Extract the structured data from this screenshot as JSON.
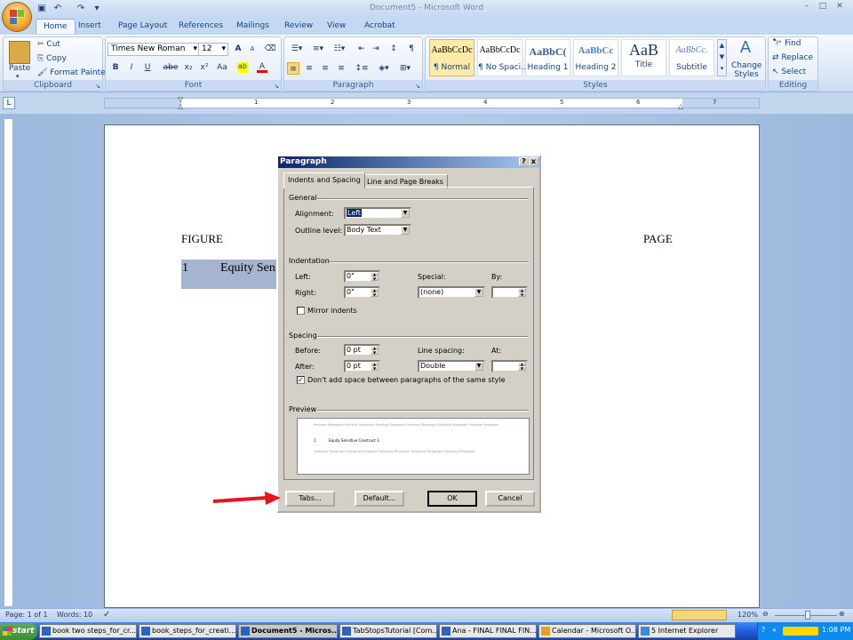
{
  "window": {
    "title": "Document5 - Microsoft Word"
  },
  "qat": {
    "save_icon": "save-icon",
    "undo_icon": "undo-icon",
    "redo_icon": "redo-icon"
  },
  "tabs": [
    "Home",
    "Insert",
    "Page Layout",
    "References",
    "Mailings",
    "Review",
    "View",
    "Acrobat"
  ],
  "clipboard": {
    "paste": "Paste",
    "cut": "Cut",
    "copy": "Copy",
    "format_painter": "Format Painter",
    "label": "Clipboard"
  },
  "font": {
    "name": "Times New Roman",
    "size": "12",
    "label": "Font",
    "bold": "B",
    "italic": "I",
    "underline": "U",
    "strike": "abe",
    "sub": "x₂",
    "sup": "x²",
    "case": "Aa",
    "grow": "A",
    "shrink": "A"
  },
  "paragraph": {
    "label": "Paragraph"
  },
  "styles": {
    "label": "Styles",
    "items": [
      {
        "sample": "AaBbCcDc",
        "name": "¶ Normal"
      },
      {
        "sample": "AaBbCcDc",
        "name": "¶ No Spaci..."
      },
      {
        "sample": "AaBbC(",
        "name": "Heading 1"
      },
      {
        "sample": "AaBbCc",
        "name": "Heading 2"
      },
      {
        "sample": "AaB",
        "name": "Title"
      },
      {
        "sample": "AaBbCc.",
        "name": "Subtitle"
      }
    ],
    "change_styles": "Change Styles"
  },
  "editing": {
    "label": "Editing",
    "find": "Find",
    "replace": "Replace",
    "select": "Select"
  },
  "ruler": {
    "marks": [
      "1",
      "2",
      "3",
      "4",
      "5",
      "6",
      "7"
    ]
  },
  "document": {
    "figure": "FIGURE",
    "page": "PAGE",
    "entry_num": "1",
    "entry_text": "Equity Sen"
  },
  "dialog": {
    "title": "Paragraph",
    "help": "?",
    "close": "x",
    "tabs": [
      "Indents and Spacing",
      "Line and Page Breaks"
    ],
    "general": "General",
    "alignment_label": "Alignment:",
    "alignment_value": "Left",
    "outline_label": "Outline level:",
    "outline_value": "Body Text",
    "indentation": "Indentation",
    "left_label": "Left:",
    "left_value": "0\"",
    "right_label": "Right:",
    "right_value": "0\"",
    "special_label": "Special:",
    "special_value": "(none)",
    "by_label": "By:",
    "mirror_label": "Mirror indents",
    "spacing": "Spacing",
    "before_label": "Before:",
    "before_value": "0 pt",
    "after_label": "After:",
    "after_value": "0 pt",
    "line_spacing_label": "Line spacing:",
    "line_spacing_value": "Double",
    "at_label": "At:",
    "dont_add_label": "Don't add space between paragraphs of the same style",
    "preview": "Preview",
    "preview_prev": "Previous Paragraph Previous Paragraph Previous Paragraph Previous Paragraph Previous Paragraph Previous Paragraph",
    "preview_num": "1",
    "preview_text": "Equity Sensitive Construct    3",
    "preview_follow": "Following Paragraph Following Paragraph Following Paragraph Following Paragraph Following Paragraph",
    "tabs_btn": "Tabs...",
    "default_btn": "Default...",
    "ok_btn": "OK",
    "cancel_btn": "Cancel"
  },
  "status": {
    "page": "Page: 1 of 1",
    "words": "Words: 10",
    "zoom": "120%"
  },
  "taskbar": {
    "start": "start",
    "tasks": [
      "book two steps_for_cr...",
      "book_steps_for_creati...",
      "Document5 - Micros...",
      "TabStopsTutorial [Com...",
      "Ana - FINAL FINAL FIN...",
      "Calendar - Microsoft O...",
      "5 Internet Explorer"
    ],
    "clock": "1:08 PM"
  },
  "colors": {
    "arrow": "#e8141b",
    "selection": "#a6b4cf",
    "dialog_title_start": "#0a246a"
  }
}
